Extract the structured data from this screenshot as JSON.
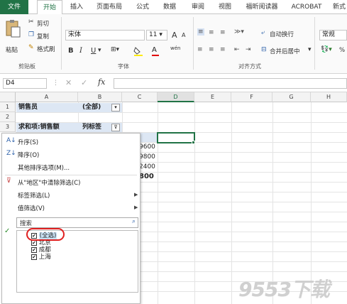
{
  "tabs": [
    "文件",
    "开始",
    "插入",
    "页面布局",
    "公式",
    "数据",
    "审阅",
    "视图",
    "福昕阅读器",
    "ACROBAT",
    "新式"
  ],
  "clipboard": {
    "paste": "粘贴",
    "cut": "剪切",
    "copy": "复制",
    "format_painter": "格式刷",
    "group": "剪贴板"
  },
  "font": {
    "name": "宋体",
    "size": "11",
    "grow": "A",
    "shrink": "A",
    "bold": "B",
    "italic": "I",
    "underline": "U",
    "group": "字体",
    "wen": "wén"
  },
  "alignment": {
    "wrap": "自动换行",
    "merge": "合并后居中",
    "group": "对齐方式"
  },
  "number": {
    "format": "常规"
  },
  "formula_bar": {
    "name_box": "D4",
    "fx": "fx"
  },
  "columns": [
    "A",
    "B",
    "C",
    "D",
    "E",
    "F",
    "G",
    "H"
  ],
  "rows": [
    "1",
    "2",
    "3"
  ],
  "cells": {
    "a1": "销售员",
    "b1": "(全部)",
    "a3": "求和项:销售额",
    "b3": "列标签",
    "c4": "9600",
    "c5": "9800",
    "c6": "2400",
    "c7": "800"
  },
  "menu": {
    "sort_asc": "升序(S)",
    "sort_desc": "降序(O)",
    "more_sort": "其他排序选项(M)...",
    "clear_filter": "从\"地区\"中清除筛选(C)",
    "label_filter": "标签筛选(L)",
    "value_filter": "值筛选(V)",
    "search_placeholder": "搜索",
    "items": [
      "(全选)",
      "北京",
      "成都",
      "上海"
    ]
  },
  "watermark": "9553下载"
}
